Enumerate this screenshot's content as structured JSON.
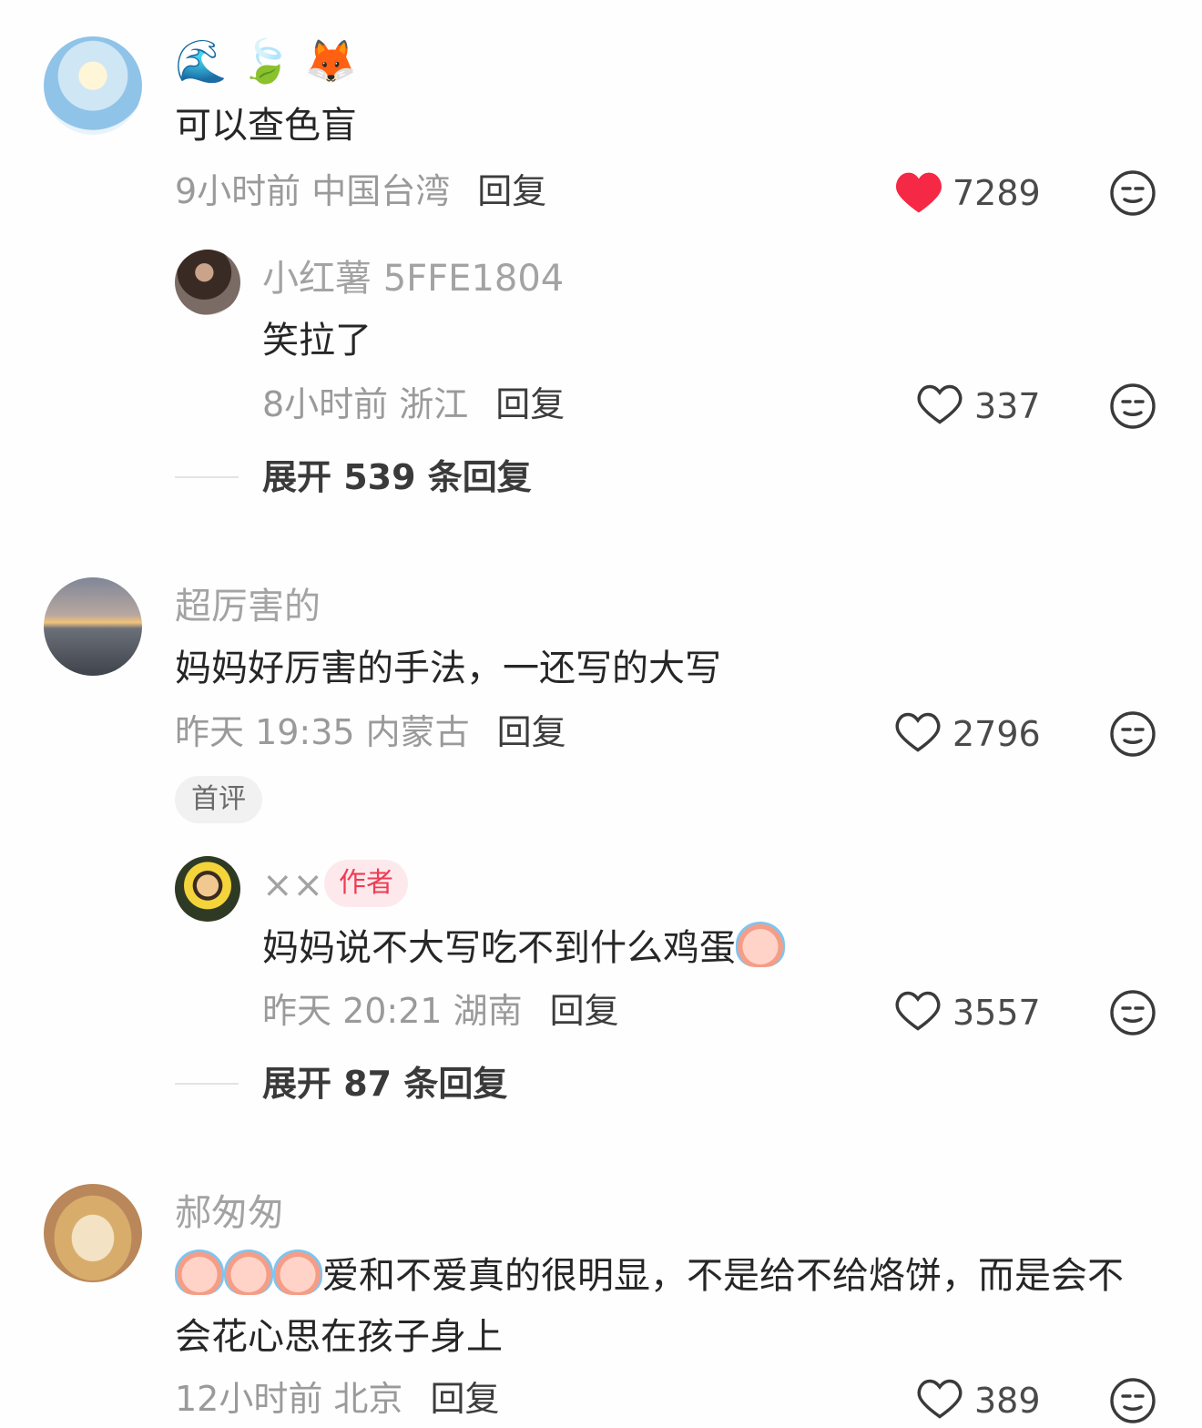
{
  "colors": {
    "liked_heart": "#f52845",
    "heart_outline": "#3a3a3a",
    "author_tag": "#ef3b54"
  },
  "comments": [
    {
      "emoji_username": [
        "🌊",
        "🍃",
        "🦊"
      ],
      "text": "可以查色盲",
      "meta": "9小时前 中国台湾",
      "reply_label": "回复",
      "likes": "7289",
      "liked": true,
      "replies": [
        {
          "username": "小红薯 5FFE1804",
          "text": "笑拉了",
          "meta": "8小时前 浙江",
          "reply_label": "回复",
          "likes": "337"
        }
      ],
      "expand": "展开 539 条回复"
    },
    {
      "username": "超厉害的",
      "text": "妈妈好厉害的手法，一还写的大写",
      "meta": "昨天 19:35 内蒙古",
      "reply_label": "回复",
      "likes": "2796",
      "badge": "首评",
      "replies": [
        {
          "username": "××",
          "author_tag": "作者",
          "text": "妈妈说不大写吃不到什么鸡蛋",
          "meta": "昨天 20:21 湖南",
          "reply_label": "回复",
          "likes": "3557"
        }
      ],
      "expand": "展开 87 条回复"
    },
    {
      "username": "郝匆匆",
      "text_line1": "爱和不爱真的很明显，不是给不给烙饼，而是会不",
      "text_line2": "会花心思在孩子身上",
      "meta": "12小时前 北京",
      "reply_label": "回复",
      "likes": "389"
    }
  ]
}
